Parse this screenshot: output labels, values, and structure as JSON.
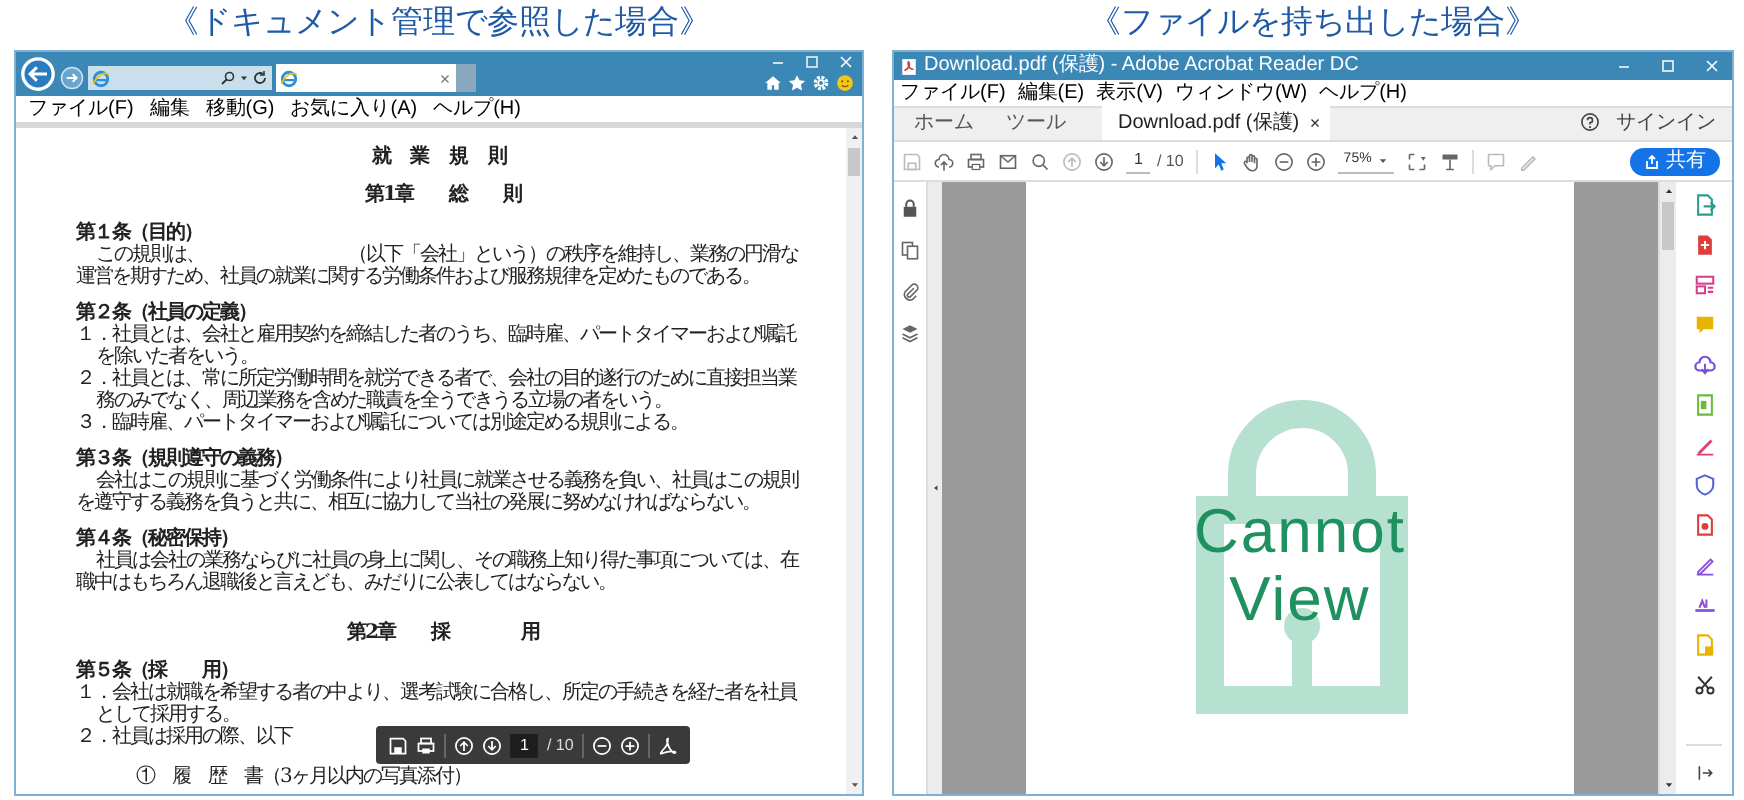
{
  "left_panel": {
    "caption": "《ドキュメント管理で参照した場合》",
    "browser": {
      "menu": [
        "ファイル(F)",
        "編集",
        "移動(G)",
        "お気に入り(A)",
        "ヘルプ(H)"
      ],
      "document": [
        {
          "kind": "title",
          "text": "就 業 規 則"
        },
        {
          "kind": "chapter",
          "text": "第1章　　総　　則"
        },
        {
          "kind": "heading",
          "text": "第１条（目的）"
        },
        {
          "kind": "paragraph",
          "text": "この規則は、　　　　　　　　（以下「会社」という）の秩序を維持し、業務の円滑な運営を期すため、社員の就業に関する労働条件および服務規律を定めたものである。"
        },
        {
          "kind": "heading",
          "text": "第２条（社員の定義）"
        },
        {
          "kind": "item",
          "text": "１．社員とは、会社と雇用契約を締結した者のうち、臨時雇、パートタイマーおよび嘱託を除いた者をいう。"
        },
        {
          "kind": "item",
          "text": "２．社員とは、常に所定労働時間を就労できる者で、会社の目的遂行のために直接担当業務のみでなく、周辺業務を含めた職責を全うできうる立場の者をいう。"
        },
        {
          "kind": "item",
          "text": "３．臨時雇、パートタイマーおよび嘱託については別途定める規則による。"
        },
        {
          "kind": "heading",
          "text": "第３条（規則遵守の義務）"
        },
        {
          "kind": "paragraph",
          "text": "会社はこの規則に基づく労働条件により社員に就業させる義務を負い、社員はこの規則を遵守する義務を負うと共に、相互に協力して当社の発展に努めなければならない。"
        },
        {
          "kind": "heading",
          "text": "第４条（秘密保持）"
        },
        {
          "kind": "paragraph",
          "text": "社員は会社の業務ならびに社員の身上に関し、その職務上知り得た事項については、在職中はもちろん退職後と言えども、みだりに公表してはならない。"
        },
        {
          "kind": "chapter",
          "text": "第2章　　採　　　　用"
        },
        {
          "kind": "heading",
          "text": "第５条（採　　用）"
        },
        {
          "kind": "item",
          "text": "１．会社は就職を希望する者の中より、選考試験に合格し、所定の手続きを経た者を社員として採用する。"
        },
        {
          "kind": "item",
          "text": "２．社員は採用の際、以下"
        },
        {
          "kind": "subitem",
          "text": "①　履　歴　書（3ヶ月以内の写真添付）"
        }
      ],
      "pdf_toolbar": {
        "page": "1",
        "total": "/ 10"
      }
    }
  },
  "right_panel": {
    "caption": "《ファイルを持ち出した場合》",
    "window_title": "Download.pdf (保護) - Adobe Acrobat Reader DC",
    "menu": [
      "ファイル(F)",
      "編集(E)",
      "表示(V)",
      "ウィンドウ(W)",
      "ヘルプ(H)"
    ],
    "tabs": [
      {
        "label": "ホーム",
        "selected": false
      },
      {
        "label": "ツール",
        "selected": false
      },
      {
        "label": "Download.pdf (保護)",
        "selected": true
      }
    ],
    "signin": "サインイン",
    "toolbar": {
      "page": "1",
      "total": "/ 10",
      "zoom": "75%"
    },
    "share_button": "共有",
    "overlay": {
      "line_1": "Cannot",
      "line_2": "View"
    }
  }
}
